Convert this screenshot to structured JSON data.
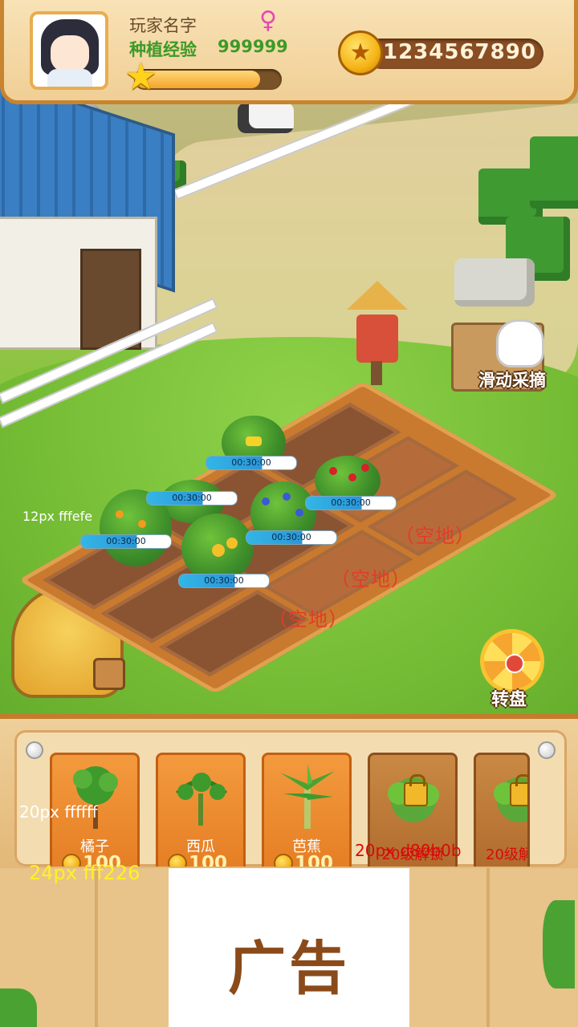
{
  "player": {
    "name": "玩家名字",
    "gender_symbol": "♀",
    "xp_label": "种植经验",
    "xp_value": "999999",
    "xp_progress": 0.86,
    "coins": "1234567890"
  },
  "actions": {
    "swipe_harvest": "滑动采摘",
    "wheel": "转盘"
  },
  "field": {
    "timers": [
      "00:30:00",
      "00:30:00",
      "00:30:00",
      "00:30:00",
      "00:30:00",
      "00:30:00"
    ],
    "empty_labels": [
      "（空地）",
      "（空地）",
      "（空地）"
    ]
  },
  "debug_notes": {
    "field_note": "12px fffefe",
    "name_note": "20px ffffff",
    "price_note": "24px fff226",
    "lock_note": "20px d80b0b"
  },
  "shop": {
    "seeds": [
      {
        "name": "橘子",
        "price": "100",
        "locked": false
      },
      {
        "name": "西瓜",
        "price": "100",
        "locked": false
      },
      {
        "name": "芭蕉",
        "price": "100",
        "locked": false
      },
      {
        "name": "20级解锁",
        "locked": true
      },
      {
        "name": "20级解",
        "locked": true
      }
    ]
  },
  "ad": {
    "label": "广告"
  },
  "colors": {
    "xp_green": "#3d9a27",
    "lock_red": "#d80b0b",
    "price_yellow": "#fff226",
    "empty_red": "#e33b2a"
  },
  "icons": [
    "avatar",
    "female-icon",
    "star-icon",
    "coin-icon",
    "glove-hand-icon",
    "prize-wheel-icon",
    "lock-icon"
  ]
}
